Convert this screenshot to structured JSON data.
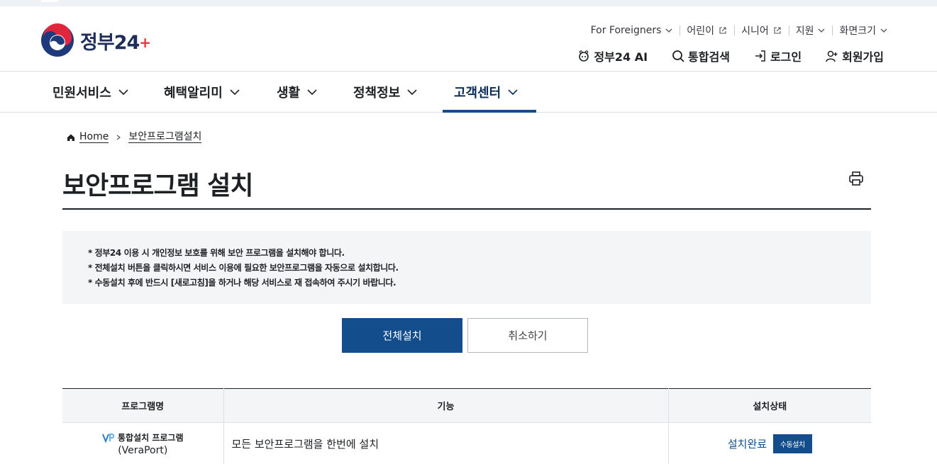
{
  "logo": {
    "text": "정부",
    "num": "24"
  },
  "util_links": [
    {
      "label": "For Foreigners",
      "icon": "chevron-down-icon"
    },
    {
      "label": "어린이",
      "icon": "external-link-icon"
    },
    {
      "label": "시니어",
      "icon": "external-link-icon"
    },
    {
      "label": "지원",
      "icon": "chevron-down-icon"
    },
    {
      "label": "화면크기",
      "icon": "chevron-down-icon"
    }
  ],
  "main_util": {
    "ai": "정부24 AI",
    "search": "통합검색",
    "login": "로그인",
    "signup": "회원가입"
  },
  "menu": [
    {
      "label": "민원서비스"
    },
    {
      "label": "혜택알리미"
    },
    {
      "label": "생활"
    },
    {
      "label": "정책정보"
    },
    {
      "label": "고객센터",
      "active": true
    }
  ],
  "breadcrumb": {
    "home": "Home",
    "current": "보안프로그램설치"
  },
  "page_title": "보안프로그램 설치",
  "notices": [
    "* 정부24 이용 시 개인정보 보호를 위해 보안 프로그램을 설치해야 합니다.",
    "* 전체설치 버튼을 클릭하시면 서비스 이용에 필요한 보안프로그램을 자동으로 설치합니다.",
    "* 수동설치 후에 반드시 [새로고침]을 하거나 해당 서비스로 재 접속하여 주시기 바랍니다."
  ],
  "buttons": {
    "install_all": "전체설치",
    "cancel": "취소하기"
  },
  "table": {
    "headers": [
      "프로그램명",
      "기능",
      "설치상태"
    ],
    "rows": [
      {
        "name": "통합설치 프로그램",
        "name_sub": "(VeraPort)",
        "function": "모든 보안프로그램을 한번에 설치",
        "status": "설치완료",
        "action": "수동설치"
      }
    ]
  },
  "colors": {
    "primary": "#134d8b",
    "title_navy": "#0b2c56",
    "notice_bg": "#f4f5f6"
  }
}
